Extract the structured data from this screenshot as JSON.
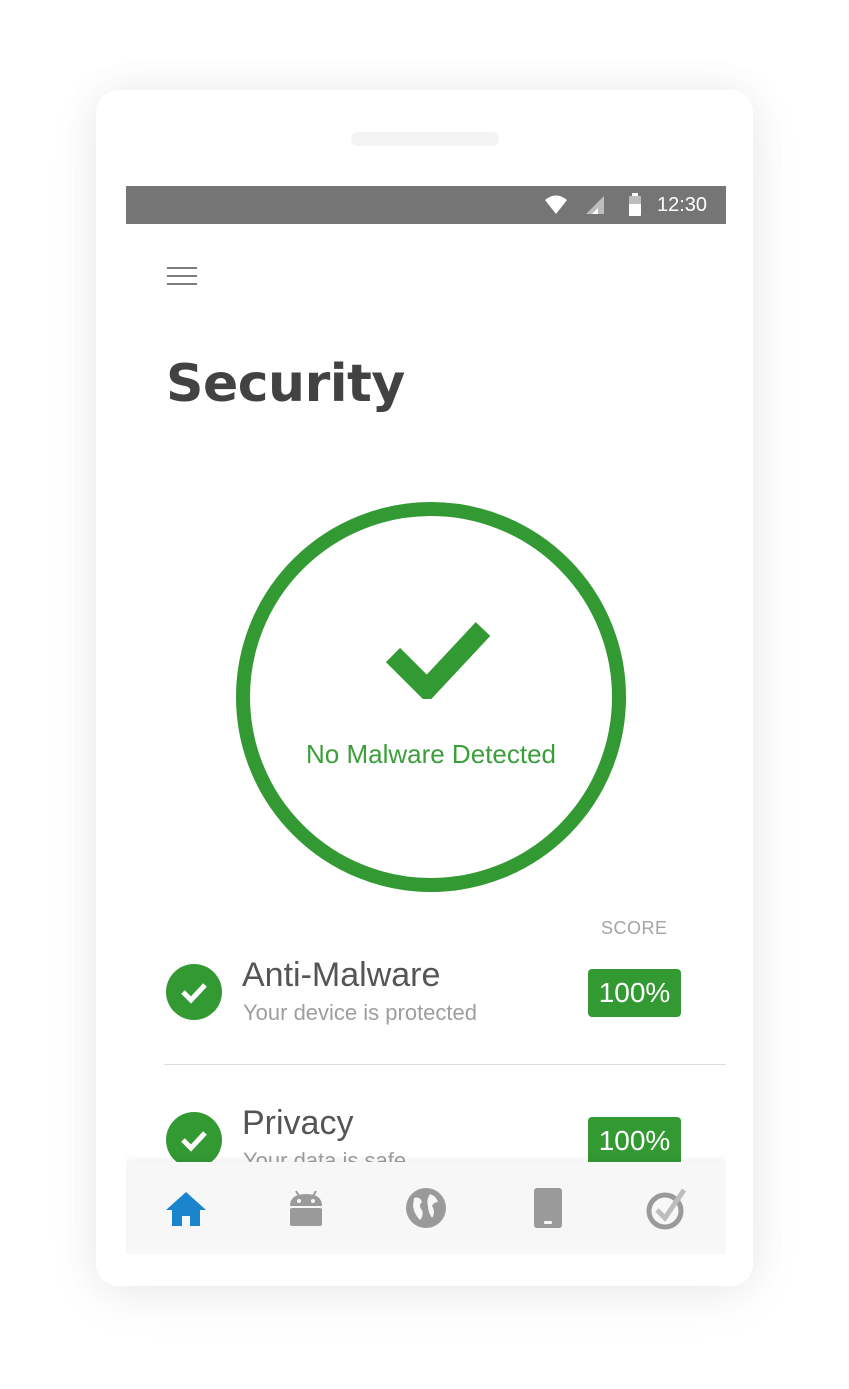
{
  "status_bar": {
    "time": "12:30",
    "icons": [
      "wifi-icon",
      "signal-icon",
      "battery-icon"
    ]
  },
  "header": {
    "menu_icon": "hamburger-menu-icon",
    "title": "Security"
  },
  "status": {
    "icon": "checkmark-icon",
    "message": "No Malware Detected"
  },
  "scores": {
    "header": "SCORE",
    "items": [
      {
        "icon": "check-circle-icon",
        "title": "Anti-Malware",
        "subtitle": "Your device is protected",
        "score": "100%"
      },
      {
        "icon": "check-circle-icon",
        "title": "Privacy",
        "subtitle": "Your data is safe",
        "score": "100%"
      }
    ]
  },
  "bottom_nav": {
    "items": [
      {
        "icon": "home-icon",
        "active": true
      },
      {
        "icon": "android-icon",
        "active": false
      },
      {
        "icon": "globe-icon",
        "active": false
      },
      {
        "icon": "phone-icon",
        "active": false
      },
      {
        "icon": "check-badge-icon",
        "active": false
      }
    ]
  },
  "colors": {
    "accent_green": "#339933",
    "status_bar": "#757575",
    "active_nav": "#1a84cc",
    "inactive_nav": "#9a9a9a",
    "title_text": "#424242"
  }
}
